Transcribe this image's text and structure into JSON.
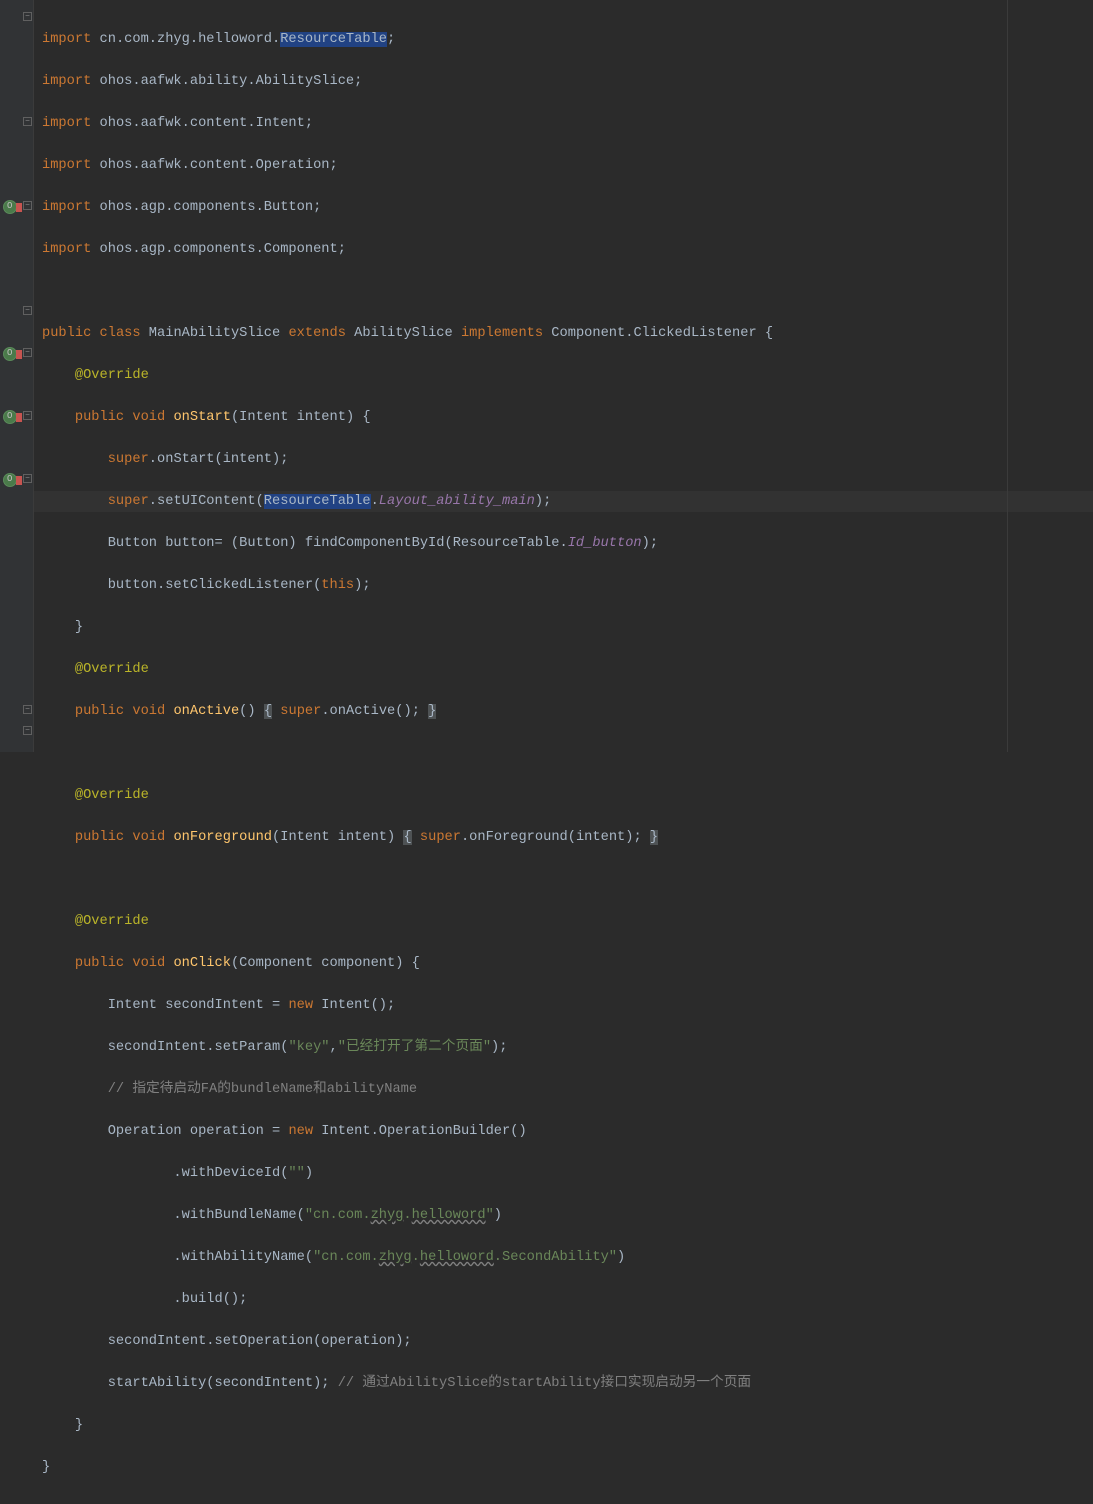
{
  "code": {
    "l1": {
      "import": "import",
      "pkg": " cn.com.zhyg.helloword.",
      "cls": "ResourceTable",
      "end": ";"
    },
    "l2": {
      "import": "import",
      "pkg": " ohos.aafwk.ability.AbilitySlice;"
    },
    "l3": {
      "import": "import",
      "pkg": " ohos.aafwk.content.Intent;"
    },
    "l4": {
      "import": "import",
      "pkg": " ohos.aafwk.content.Operation;"
    },
    "l5": {
      "import": "import",
      "pkg": " ohos.agp.components.Button;"
    },
    "l6": {
      "import": "import",
      "pkg": " ohos.agp.components.Component;"
    },
    "l8": {
      "pub": "public",
      "cls": "class",
      "name": " MainAbilitySlice ",
      "ext": "extends",
      "ext2": " AbilitySlice ",
      "impl": "implements",
      "impl2": " Component.ClickedListener {"
    },
    "l9": {
      "ann": "@Override"
    },
    "l10": {
      "pub": "public",
      "void": "void",
      "fn": "onStart",
      "sig": "(Intent intent) {"
    },
    "l11": {
      "super": "super",
      "call": ".onStart(intent);"
    },
    "l12": {
      "super": "super",
      "call": ".setUIContent(",
      "sel": "ResourceTable",
      "dot": ".",
      "field": "Layout_ability_main",
      "end": ");"
    },
    "l13": {
      "txt1": "Button button= (Button) findComponentById(ResourceTable.",
      "field": "Id_button",
      "end": ");"
    },
    "l14": {
      "txt1": "button.setClickedListener(",
      "this": "this",
      "end": ");"
    },
    "l15": {
      "brace": "}"
    },
    "l16": {
      "ann": "@Override"
    },
    "l17": {
      "pub": "public",
      "void": "void",
      "fn": "onActive",
      "sig": "() ",
      "lb": "{",
      "super": " super",
      "call": ".onActive(); ",
      "rb": "}"
    },
    "l19": {
      "ann": "@Override"
    },
    "l20": {
      "pub": "public",
      "void": "void",
      "fn": "onForeground",
      "sig": "(Intent intent) ",
      "lb": "{",
      "super": " super",
      "call": ".onForeground(intent); ",
      "rb": "}"
    },
    "l22": {
      "ann": "@Override"
    },
    "l23": {
      "pub": "public",
      "void": "void",
      "fn": "onClick",
      "sig": "(Component component) {"
    },
    "l24": {
      "txt1": "Intent secondIntent = ",
      "new": "new",
      "txt2": " Intent();"
    },
    "l25": {
      "txt1": "secondIntent.setParam(",
      "str1": "\"key\"",
      "comma": ",",
      "str2": "\"已经打开了第二个页面\"",
      "end": ");"
    },
    "l26": {
      "cmt": "// 指定待启动FA的bundleName和abilityName"
    },
    "l27": {
      "txt1": "Operation operation = ",
      "new": "new",
      "txt2": " Intent.OperationBuilder()"
    },
    "l28": {
      "txt1": ".withDeviceId(",
      "str": "\"\"",
      "end": ")"
    },
    "l29": {
      "txt1": ".withBundleName(",
      "str1": "\"cn.com.",
      "u": "zhyg",
      "dot": ".",
      "u2": "helloword",
      "str2": "\"",
      "end": ")"
    },
    "l30": {
      "txt1": ".withAbilityName(",
      "str1": "\"cn.com.",
      "u": "zhyg",
      "dot": ".",
      "u2": "helloword",
      "str2": ".SecondAbility\"",
      "end": ")"
    },
    "l31": {
      "txt1": ".build();"
    },
    "l32": {
      "txt1": "secondIntent.setOperation(operation);"
    },
    "l33": {
      "txt1": "startAbility(secondIntent); ",
      "cmt": "// 通过AbilitySlice的startAbility接口实现启动另一个页面"
    },
    "l34": {
      "brace": "}"
    },
    "l35": {
      "brace": "}"
    }
  }
}
